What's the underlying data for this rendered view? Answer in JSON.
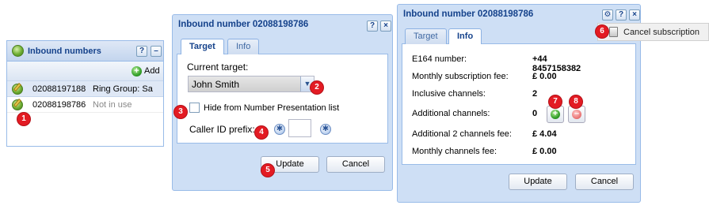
{
  "panel": {
    "title": "Inbound numbers",
    "add_label": "Add",
    "rows": [
      {
        "number": "02088197188",
        "status": "Ring Group: Sa"
      },
      {
        "number": "02088198786",
        "status": "Not in use"
      }
    ]
  },
  "dialog_target": {
    "title": "Inbound number 02088198786",
    "tabs": [
      "Target",
      "Info"
    ],
    "current_target_label": "Current target:",
    "current_target_value": "John Smith",
    "hide_label": "Hide from Number Presentation list",
    "callerid_label": "Caller ID prefix:",
    "update_label": "Update",
    "cancel_label": "Cancel"
  },
  "dialog_info": {
    "title": "Inbound number 02088198786",
    "tabs": [
      "Target",
      "Info"
    ],
    "rows": [
      {
        "key": "E164 number:",
        "value": "+44 8457158382"
      },
      {
        "key": "Monthly subscription fee:",
        "value": "£ 0.00"
      },
      {
        "key": "Inclusive channels:",
        "value": "2"
      },
      {
        "key": "Additional channels:",
        "value": "0"
      },
      {
        "key": "Additional 2 channels fee:",
        "value": "£ 4.04"
      },
      {
        "key": "Monthly channels fee:",
        "value": "£ 0.00"
      }
    ],
    "update_label": "Update",
    "cancel_label": "Cancel"
  },
  "menu": {
    "cancel_subscription": "Cancel subscription"
  },
  "callouts": [
    "1",
    "2",
    "3",
    "4",
    "5",
    "6",
    "7",
    "8"
  ],
  "colors": {
    "header_text": "#15428b",
    "callout": "#e31b23",
    "window_bg": "#cedff5"
  }
}
